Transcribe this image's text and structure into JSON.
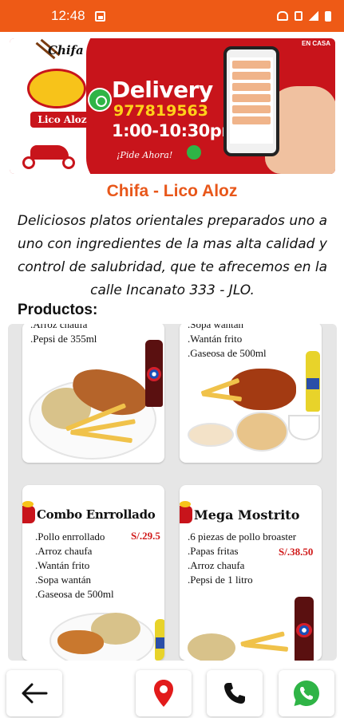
{
  "status_bar": {
    "time": "12:48",
    "bg_color": "#ee5a16"
  },
  "banner": {
    "logo_script": "Chifa",
    "logo_name": "Lico Aloz",
    "headline": "Delivery",
    "phone": "977819563",
    "hours": "1:00-10:30pm",
    "call_to_action": "¡Pide Ahora!",
    "corner_tag": "EN CASA",
    "colors": {
      "red": "#c8141b",
      "yellow": "#ffd21a",
      "whatsapp_green": "#2fb446"
    }
  },
  "page": {
    "title": "Chifa - Lico Aloz",
    "title_color": "#e8571a",
    "description": "Deliciosos platos orientales preparados uno a uno con ingredientes de la mas alta calidad y control de salubridad, que te afrecemos en la calle Incanato 333 - JLO.",
    "products_heading": "Productos:"
  },
  "products": [
    {
      "name": "",
      "items": [
        ".Arroz chaufa",
        ".Pepsi de 355ml"
      ],
      "price": "",
      "image_icons": [
        "fried-chicken-icon",
        "fries-icon",
        "rice-icon",
        "pepsi-bottle-icon"
      ]
    },
    {
      "name": "",
      "items": [
        ".Sopa wantán",
        ".Wantán frito",
        ".Gaseosa de 500ml"
      ],
      "price": "",
      "image_icons": [
        "chicken-wings-icon",
        "fries-icon",
        "rice-bowl-icon",
        "soda-bottle-icon"
      ]
    },
    {
      "name": "Combo Enrrollado",
      "items": [
        ".Pollo enrrollado",
        ".Arroz chaufa",
        ".Wantán frito",
        ".Sopa wantán",
        ".Gaseosa de 500ml"
      ],
      "price": "S/.29.5",
      "image_icons": [
        "rice-icon",
        "chicken-roll-icon",
        "soda-bottle-icon"
      ]
    },
    {
      "name": "Mega Mostrito",
      "items": [
        ".6 piezas de pollo broaster",
        ".Papas fritas",
        ".Arroz chaufa",
        ".Pepsi de 1 litro"
      ],
      "price": "S/.38.50",
      "image_icons": [
        "rice-icon",
        "fries-icon",
        "pepsi-bottle-icon"
      ]
    }
  ],
  "bottom_nav": [
    {
      "name": "back",
      "icon": "arrow-left-icon"
    },
    {
      "name": "location",
      "icon": "map-pin-icon",
      "color": "#e21b1b"
    },
    {
      "name": "call",
      "icon": "phone-icon"
    },
    {
      "name": "whatsapp",
      "icon": "whatsapp-icon",
      "color": "#2fb446"
    }
  ]
}
